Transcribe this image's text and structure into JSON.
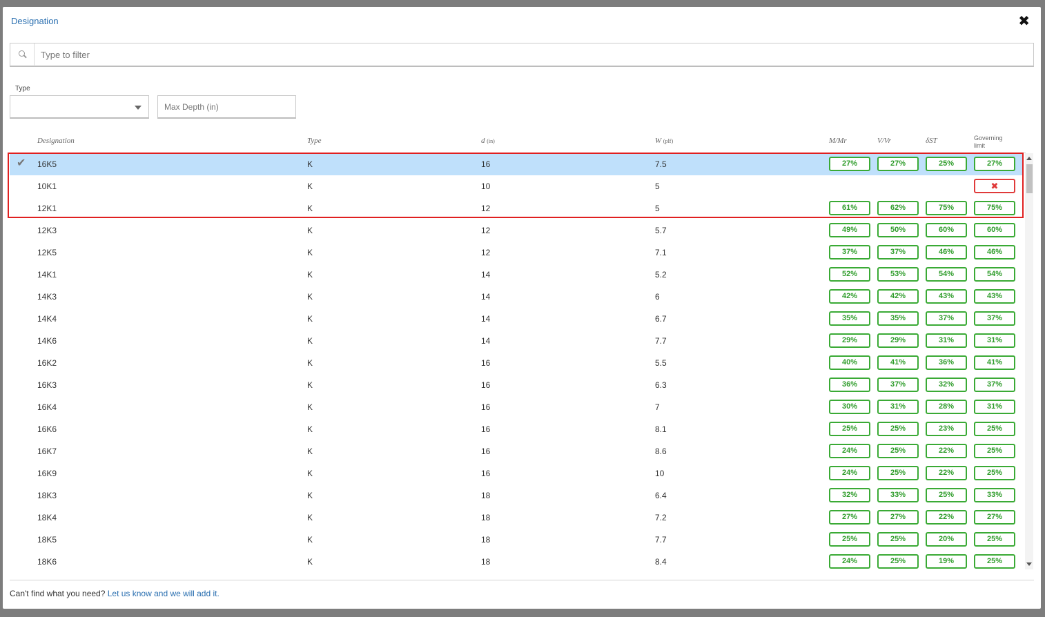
{
  "dialog": {
    "title": "Designation",
    "close_symbol": "✖",
    "search_placeholder": "Type to filter",
    "type_label": "Type",
    "type_selected": "",
    "max_depth_placeholder": "Max Depth (in)",
    "footer_text": "Can't find what you need?",
    "footer_link": "Let us know and we will add it."
  },
  "icons": {
    "close": "close-icon",
    "search": "search-icon",
    "dropdown": "chevron-down-icon",
    "check": "checkmark-icon",
    "fail": "x-icon"
  },
  "colors": {
    "pass": "#3aaa35",
    "fail": "#e03a3a",
    "selected_row": "#bfe0fb",
    "link": "#2a6fb0"
  },
  "columns": {
    "designation": "Designation",
    "type": "Type",
    "depth": "d",
    "depth_unit": "(in)",
    "weight": "W",
    "weight_unit": "(plf)",
    "m": "M/Mr",
    "v": "V/Vr",
    "delta": "δST",
    "governing_1": "Governing",
    "governing_2": "limit"
  },
  "rows": [
    {
      "designation": "16K5",
      "type": "K",
      "d": "16",
      "w": "7.5",
      "m": "27%",
      "v": "27%",
      "delta": "25%",
      "gov": "27%",
      "selected": true
    },
    {
      "designation": "10K1",
      "type": "K",
      "d": "10",
      "w": "5",
      "m": "",
      "v": "",
      "delta": "",
      "gov": "✖",
      "fail": true
    },
    {
      "designation": "12K1",
      "type": "K",
      "d": "12",
      "w": "5",
      "m": "61%",
      "v": "62%",
      "delta": "75%",
      "gov": "75%"
    },
    {
      "designation": "12K3",
      "type": "K",
      "d": "12",
      "w": "5.7",
      "m": "49%",
      "v": "50%",
      "delta": "60%",
      "gov": "60%"
    },
    {
      "designation": "12K5",
      "type": "K",
      "d": "12",
      "w": "7.1",
      "m": "37%",
      "v": "37%",
      "delta": "46%",
      "gov": "46%"
    },
    {
      "designation": "14K1",
      "type": "K",
      "d": "14",
      "w": "5.2",
      "m": "52%",
      "v": "53%",
      "delta": "54%",
      "gov": "54%"
    },
    {
      "designation": "14K3",
      "type": "K",
      "d": "14",
      "w": "6",
      "m": "42%",
      "v": "42%",
      "delta": "43%",
      "gov": "43%"
    },
    {
      "designation": "14K4",
      "type": "K",
      "d": "14",
      "w": "6.7",
      "m": "35%",
      "v": "35%",
      "delta": "37%",
      "gov": "37%"
    },
    {
      "designation": "14K6",
      "type": "K",
      "d": "14",
      "w": "7.7",
      "m": "29%",
      "v": "29%",
      "delta": "31%",
      "gov": "31%"
    },
    {
      "designation": "16K2",
      "type": "K",
      "d": "16",
      "w": "5.5",
      "m": "40%",
      "v": "41%",
      "delta": "36%",
      "gov": "41%"
    },
    {
      "designation": "16K3",
      "type": "K",
      "d": "16",
      "w": "6.3",
      "m": "36%",
      "v": "37%",
      "delta": "32%",
      "gov": "37%"
    },
    {
      "designation": "16K4",
      "type": "K",
      "d": "16",
      "w": "7",
      "m": "30%",
      "v": "31%",
      "delta": "28%",
      "gov": "31%"
    },
    {
      "designation": "16K6",
      "type": "K",
      "d": "16",
      "w": "8.1",
      "m": "25%",
      "v": "25%",
      "delta": "23%",
      "gov": "25%"
    },
    {
      "designation": "16K7",
      "type": "K",
      "d": "16",
      "w": "8.6",
      "m": "24%",
      "v": "25%",
      "delta": "22%",
      "gov": "25%"
    },
    {
      "designation": "16K9",
      "type": "K",
      "d": "16",
      "w": "10",
      "m": "24%",
      "v": "25%",
      "delta": "22%",
      "gov": "25%"
    },
    {
      "designation": "18K3",
      "type": "K",
      "d": "18",
      "w": "6.4",
      "m": "32%",
      "v": "33%",
      "delta": "25%",
      "gov": "33%"
    },
    {
      "designation": "18K4",
      "type": "K",
      "d": "18",
      "w": "7.2",
      "m": "27%",
      "v": "27%",
      "delta": "22%",
      "gov": "27%"
    },
    {
      "designation": "18K5",
      "type": "K",
      "d": "18",
      "w": "7.7",
      "m": "25%",
      "v": "25%",
      "delta": "20%",
      "gov": "25%"
    },
    {
      "designation": "18K6",
      "type": "K",
      "d": "18",
      "w": "8.4",
      "m": "24%",
      "v": "25%",
      "delta": "19%",
      "gov": "25%"
    }
  ]
}
